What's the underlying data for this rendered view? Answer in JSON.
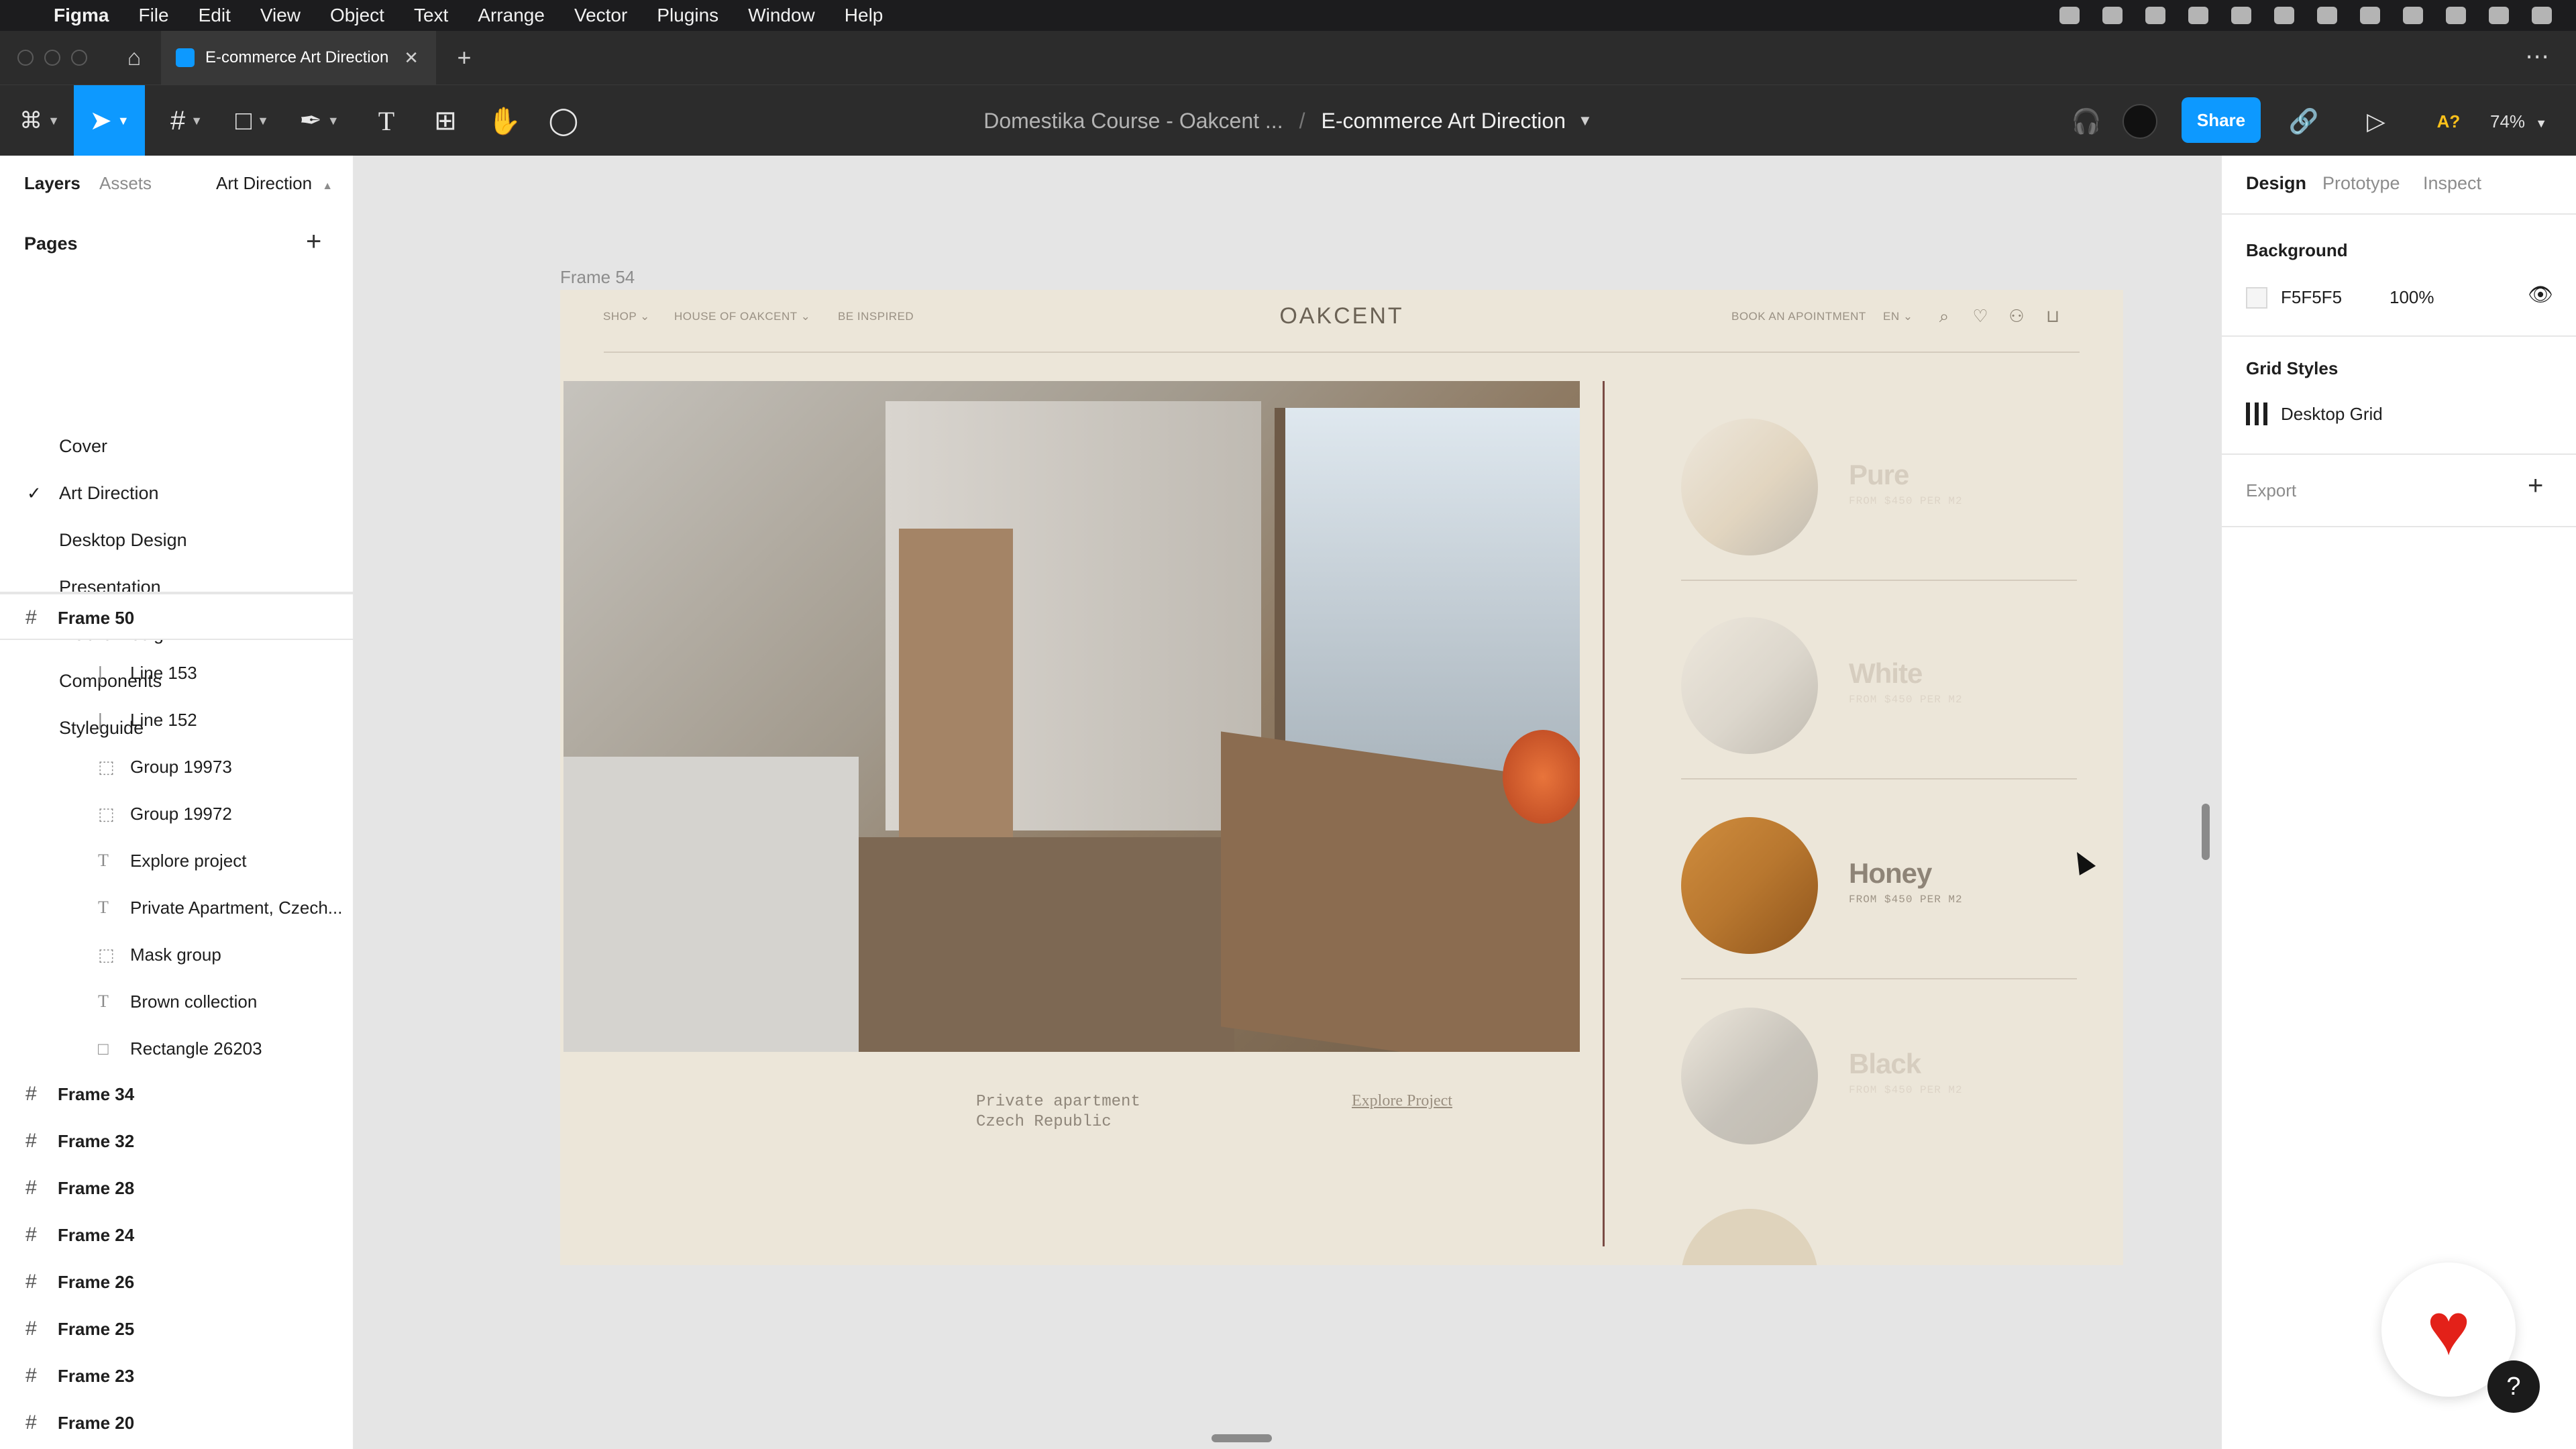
{
  "menubar": {
    "apple": "",
    "items": [
      "Figma",
      "File",
      "Edit",
      "View",
      "Object",
      "Text",
      "Arrange",
      "Vector",
      "Plugins",
      "Window",
      "Help"
    ]
  },
  "tabstrip": {
    "home": "⌂",
    "file_tab": "E-commerce Art Direction",
    "close": "✕",
    "add": "+",
    "more": "⋯"
  },
  "toolbar": {
    "breadcrumb_project": "Domestika Course - Oakcent ...",
    "breadcrumb_sep": "/",
    "breadcrumb_file": "E-commerce Art Direction",
    "share_label": "Share",
    "missing_fonts": "A?",
    "zoom": "74%"
  },
  "left_panel": {
    "tabs": [
      "Layers",
      "Assets"
    ],
    "page_selector": "Art Direction",
    "pages_title": "Pages",
    "pages": [
      {
        "label": "Cover",
        "selected": false
      },
      {
        "label": "Art Direction",
        "selected": true
      },
      {
        "label": "Desktop Design",
        "selected": false
      },
      {
        "label": "Presentation",
        "selected": false
      },
      {
        "label": "Mobile Design",
        "selected": false
      },
      {
        "label": "Components",
        "selected": false
      },
      {
        "label": "Styleguide",
        "selected": false
      }
    ],
    "check": "✓",
    "layers": {
      "frame50": "Frame 50",
      "children": [
        "Line 153",
        "Line 152",
        "Group 19973",
        "Group 19972",
        "Explore project",
        "Private Apartment, Czech...",
        "Mask group",
        "Brown collection",
        "Rectangle 26203"
      ],
      "frames": [
        "Frame 34",
        "Frame 32",
        "Frame 28",
        "Frame 24",
        "Frame 26",
        "Frame 25",
        "Frame 23",
        "Frame 20"
      ]
    }
  },
  "canvas": {
    "frame_label": "Frame 54",
    "site": {
      "nav_left": [
        "SHOP",
        "HOUSE OF OAKCENT",
        "BE INSPIRED"
      ],
      "brand": "OAKCENT",
      "nav_right": [
        "BOOK AN APOINTMENT",
        "EN"
      ],
      "caption_line1": "Private apartment",
      "caption_line2": "Czech Republic",
      "explore_link": "Explore Project",
      "swatches": [
        {
          "name": "Pure",
          "price": "FROM $450 PER M2",
          "color": "#d9c7ab",
          "active": false
        },
        {
          "name": "White",
          "price": "FROM $450 PER M2",
          "color": "#cfcac2",
          "active": false
        },
        {
          "name": "Honey",
          "price": "FROM $450 PER M2",
          "color": "#b8772f",
          "active": true
        },
        {
          "name": "Black",
          "price": "FROM $450 PER M2",
          "color": "#a9a6a1",
          "active": false
        }
      ]
    }
  },
  "right_panel": {
    "tabs": [
      "Design",
      "Prototype",
      "Inspect"
    ],
    "background_heading": "Background",
    "background_hex": "F5F5F5",
    "background_opacity": "100%",
    "grid_heading": "Grid Styles",
    "grid_name": "Desktop Grid",
    "export_heading": "Export"
  },
  "help": "?",
  "colors": {
    "accent": "#0d99ff",
    "frame_bg": "#ece6d9",
    "domestika_red": "#e32119"
  }
}
